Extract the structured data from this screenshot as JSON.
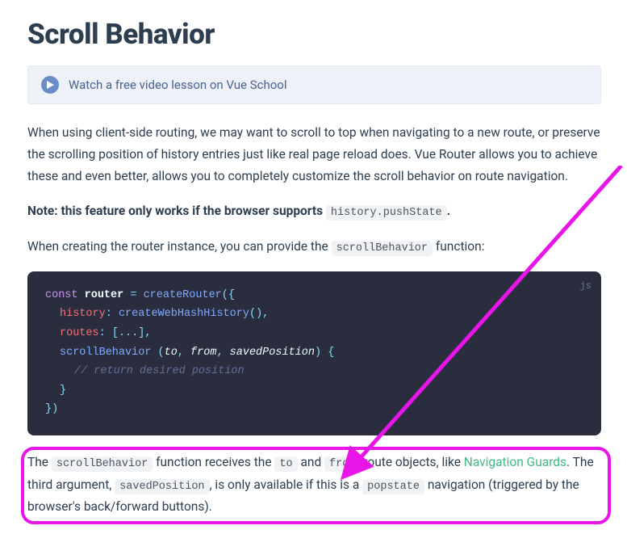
{
  "heading": "Scroll Behavior",
  "vueschool": {
    "text": "Watch a free video lesson on Vue School"
  },
  "intro": "When using client-side routing, we may want to scroll to top when navigating to a new route, or preserve the scrolling position of history entries just like real page reload does. Vue Router allows you to achieve these and even better, allows you to completely customize the scroll behavior on route navigation.",
  "note": {
    "prefix": "Note: this feature only works if the browser supports ",
    "code": "history.pushState",
    "suffix": "."
  },
  "preCode": {
    "prefix": "When creating the router instance, you can provide the ",
    "code": "scrollBehavior",
    "suffix": " function:"
  },
  "code": {
    "lang": "js",
    "l1_const": "const",
    "l1_router": "router",
    "l1_eq": "=",
    "l1_createRouter": "createRouter",
    "l1_open": "({",
    "l2_history": "history",
    "l2_colon": ":",
    "l2_createWebHash": "createWebHashHistory",
    "l2_paren": "(),",
    "l3_routes": "routes",
    "l3_colon": ":",
    "l3_arr": "[...],",
    "l4_scrollBehavior": "scrollBehavior",
    "l4_paren_open": "(",
    "l4_to": "to",
    "l4_c1": ", ",
    "l4_from": "from",
    "l4_c2": ", ",
    "l4_saved": "savedPosition",
    "l4_paren_close": ")",
    "l4_brace": "{",
    "l5_comment": "// return desired position",
    "l6_close": "}",
    "l7_close": "})"
  },
  "desc": {
    "t1": "The ",
    "c1": "scrollBehavior",
    "t2": " function receives the ",
    "c2": "to",
    "t3": " and ",
    "c3": "from",
    "t4": " route objects, like ",
    "link": "Navigation Guards",
    "t5": ". The third argument, ",
    "c4": "savedPosition",
    "t6": ", is only available if this is a ",
    "c5": "popstate",
    "t7": " navigation (triggered by the browser's back/forward buttons)."
  },
  "annotation": {
    "arrow_color": "#e815e8"
  }
}
